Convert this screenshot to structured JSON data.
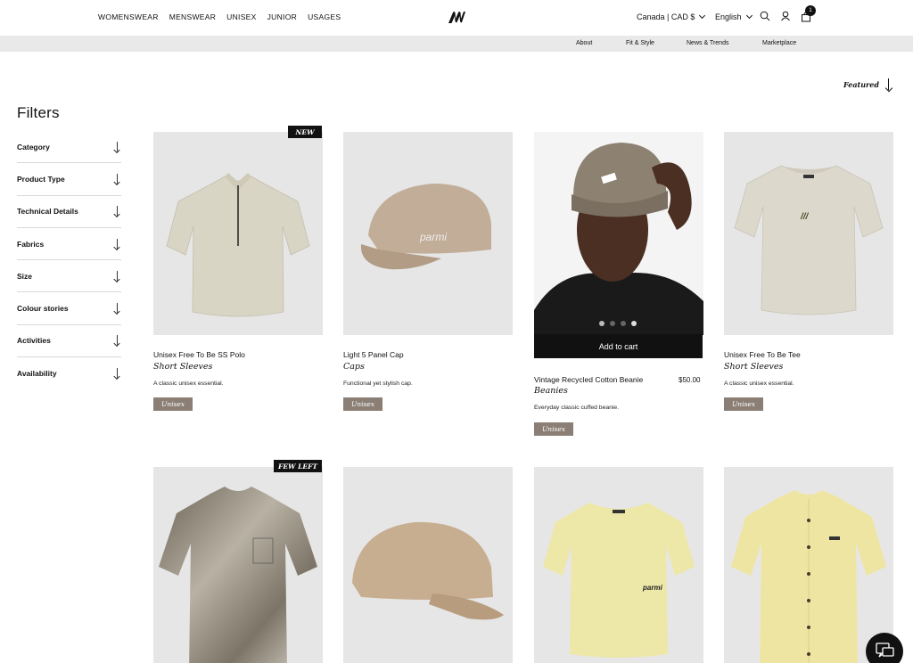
{
  "nav": {
    "items": [
      "WOMENSWEAR",
      "MENSWEAR",
      "UNISEX",
      "JUNIOR",
      "USAGES"
    ],
    "locale": "Canada | CAD $",
    "language": "English",
    "cart_count": "1"
  },
  "subnav": {
    "items": [
      "About",
      "Fit & Style",
      "News & Trends",
      "Marketplace"
    ]
  },
  "sort": {
    "label": "Featured"
  },
  "filters": {
    "title": "Filters",
    "items": [
      "Category",
      "Product Type",
      "Technical Details",
      "Fabrics",
      "Size",
      "Colour stories",
      "Activities",
      "Availability"
    ]
  },
  "products": [
    {
      "name": "Unisex Free To Be SS Polo",
      "category": "Short Sleeves",
      "desc": "A classic unisex essential.",
      "tag": "Unisex",
      "badge": "NEW"
    },
    {
      "name": "Light 5 Panel Cap",
      "category": "Caps",
      "desc": "Functional yet stylish cap.",
      "tag": "Unisex",
      "print": "parmi"
    },
    {
      "name": "Vintage Recycled Cotton Beanie",
      "category": "Beanies",
      "desc": "Everyday classic cuffed beanie.",
      "tag": "Unisex",
      "price": "$50.00",
      "add_to_cart": "Add to cart"
    },
    {
      "name": "Unisex Free To Be Tee",
      "category": "Short Sleeves",
      "desc": "A classic unisex essential.",
      "tag": "Unisex"
    }
  ],
  "second_row": {
    "badge": "FEW LEFT",
    "tee_print": "parmi"
  },
  "colors": {
    "tag": "#8b7f75",
    "image_bg": "#e6e6e6",
    "subbar": "#e9e9e9"
  }
}
